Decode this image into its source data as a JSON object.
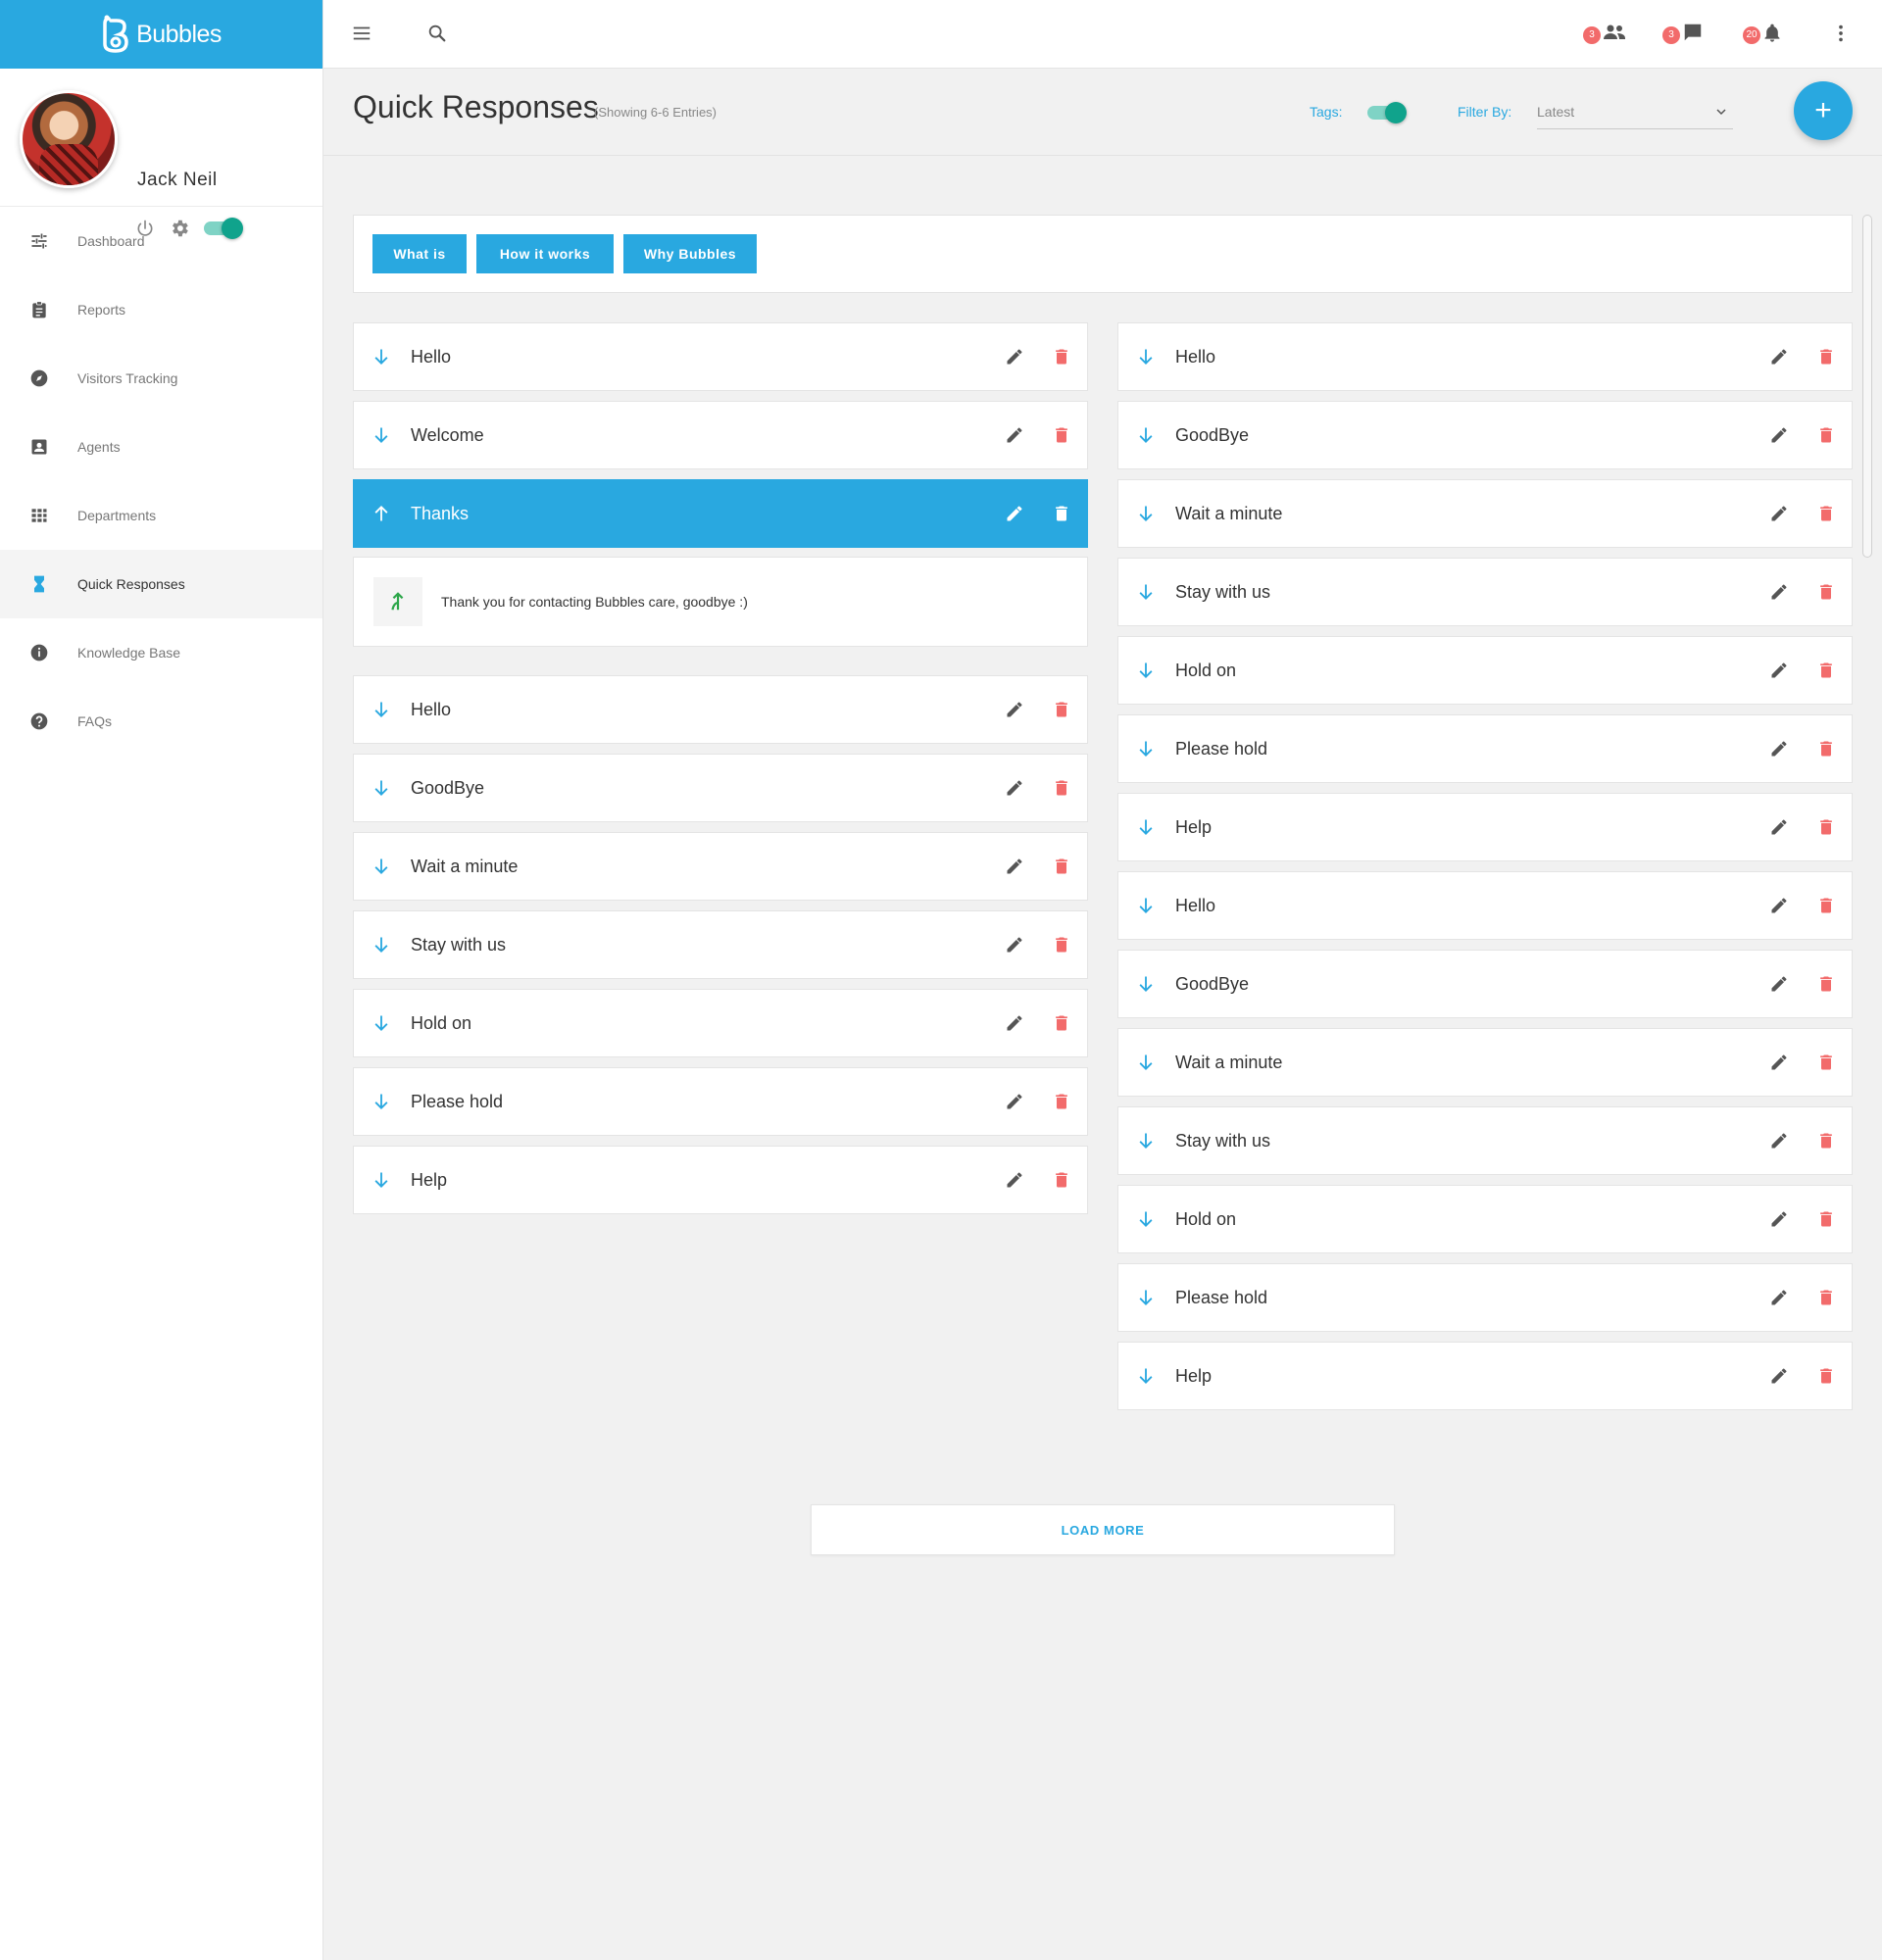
{
  "app": {
    "brand": "Bubbles"
  },
  "colors": {
    "accent": "#29a8e0",
    "danger": "#f26b6b",
    "toggle": "#10a38c"
  },
  "profile": {
    "name": "Jack Neil",
    "status_toggle": "on"
  },
  "sidebar": {
    "items": [
      {
        "label": "Dashboard",
        "icon": "sliders-icon"
      },
      {
        "label": "Reports",
        "icon": "clipboard-icon"
      },
      {
        "label": "Visitors Tracking",
        "icon": "compass-icon"
      },
      {
        "label": "Agents",
        "icon": "contact-card-icon"
      },
      {
        "label": "Departments",
        "icon": "grid-icon"
      },
      {
        "label": "Quick Responses",
        "icon": "hourglass-icon",
        "active": true
      },
      {
        "label": "Knowledge Base",
        "icon": "info-icon"
      },
      {
        "label": "FAQs",
        "icon": "help-icon"
      }
    ]
  },
  "topbar": {
    "notifications": [
      {
        "count": "3",
        "icon": "people-icon"
      },
      {
        "count": "3",
        "icon": "chat-icon"
      },
      {
        "count": "20",
        "icon": "bell-icon"
      }
    ]
  },
  "header": {
    "title": "Quick Responses",
    "subtitle": "(Showing 6-6 Entries)",
    "tags_label": "Tags:",
    "tags_toggle": "on",
    "filter_label": "Filter By:",
    "filter_value": "Latest",
    "add_button": "+"
  },
  "tags": [
    "What is",
    "How it works",
    "Why Bubbles"
  ],
  "left_column": {
    "top": [
      {
        "label": "Hello"
      },
      {
        "label": "Welcome"
      },
      {
        "label": "Thanks",
        "expanded": true
      }
    ],
    "expanded_text": "Thank you for contacting Bubbles care, goodbye :)",
    "bottom": [
      {
        "label": "Hello"
      },
      {
        "label": "GoodBye"
      },
      {
        "label": "Wait a minute"
      },
      {
        "label": "Stay with us"
      },
      {
        "label": "Hold on"
      },
      {
        "label": "Please hold"
      },
      {
        "label": "Help"
      }
    ]
  },
  "right_column": [
    {
      "label": "Hello"
    },
    {
      "label": "GoodBye"
    },
    {
      "label": "Wait a minute"
    },
    {
      "label": "Stay with us"
    },
    {
      "label": "Hold on"
    },
    {
      "label": "Please hold"
    },
    {
      "label": "Help"
    },
    {
      "label": "Hello"
    },
    {
      "label": "GoodBye"
    },
    {
      "label": "Wait a minute"
    },
    {
      "label": "Stay with us"
    },
    {
      "label": "Hold on"
    },
    {
      "label": "Please hold"
    },
    {
      "label": "Help"
    }
  ],
  "load_more_label": "LOAD MORE"
}
